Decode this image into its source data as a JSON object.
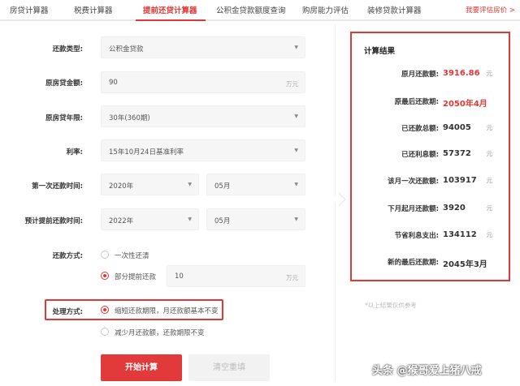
{
  "tabs": [
    {
      "label": "房贷计算器"
    },
    {
      "label": "税费计算器"
    },
    {
      "label": "提前还贷计算器"
    },
    {
      "label": "公积金贷款额度查询"
    },
    {
      "label": "购房能力评估"
    },
    {
      "label": "装修贷款计算器"
    }
  ],
  "active_tab": "提前还贷计算器",
  "tab_link": "我要评估房价 >",
  "form": {
    "loan_type": {
      "label": "还款类型:",
      "value": "公积金贷款"
    },
    "loan_amount": {
      "label": "原房贷金额:",
      "value": "90",
      "unit": "万元"
    },
    "loan_years": {
      "label": "原房贷年限:",
      "value": "30年(360期)"
    },
    "rate": {
      "label": "利率:",
      "value": "15年10月24日基准利率"
    },
    "first_payment": {
      "label": "第一次还款时间:",
      "year": "2020年",
      "month": "05月"
    },
    "prepay_time": {
      "label": "预计提前还款时间:",
      "year": "2022年",
      "month": "05月"
    },
    "repay_method": {
      "label": "还款方式:",
      "option_full": "一次性还清",
      "option_partial": "部分提前还款",
      "partial_amount": "10",
      "partial_unit": "万元"
    },
    "handling": {
      "label": "处理方式:",
      "option_shorten": "缩短还款期限，月还款额基本不变",
      "option_reduce": "减少月还款额，还款期限不变"
    }
  },
  "buttons": {
    "calculate": "开始计算",
    "clear": "清空重填"
  },
  "results": {
    "title": "计算结果",
    "rows": [
      {
        "label": "原月还款额:",
        "value": "3916.86",
        "unit": "元"
      },
      {
        "label": "原最后还款期:",
        "value": "2050年4月",
        "unit": ""
      },
      {
        "label": "已还款总额:",
        "value": "94005",
        "unit": "元"
      },
      {
        "label": "已还利息额:",
        "value": "57372",
        "unit": "元"
      },
      {
        "label": "该月一次还款额:",
        "value": "103917",
        "unit": "元"
      },
      {
        "label": "下月起月还款额:",
        "value": "3920",
        "unit": "元"
      },
      {
        "label": "节省利息支出:",
        "value": "134112",
        "unit": "元"
      },
      {
        "label": "新的最后还款期:",
        "value": "2045年3月",
        "unit": ""
      }
    ]
  },
  "note": "*以上结果仅供参考",
  "watermark": "头条 @猴哥爱上猪八戒",
  "colors": {
    "accent": "#e03737",
    "field_bg": "#f6f6f6"
  }
}
